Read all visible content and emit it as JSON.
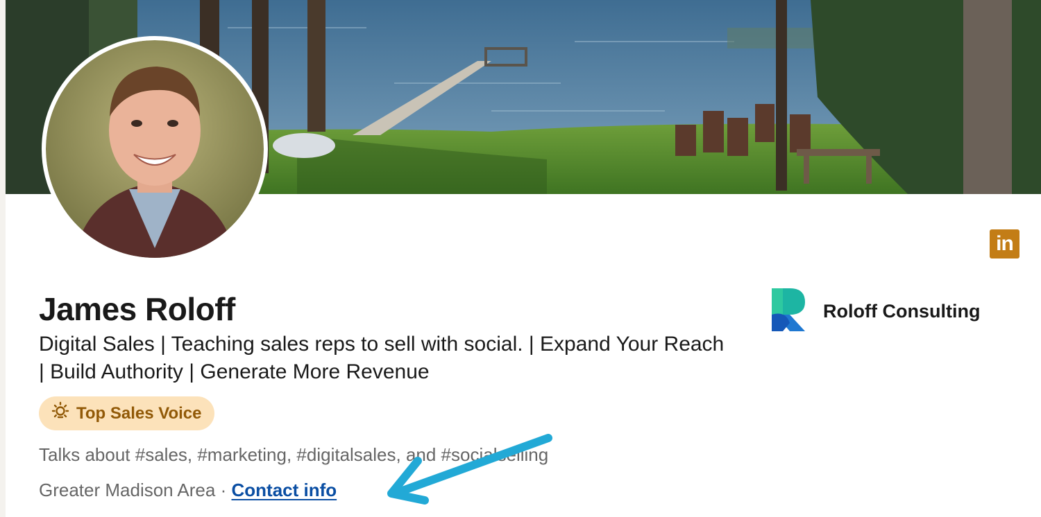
{
  "profile": {
    "name": "James Roloff",
    "headline": "Digital Sales | Teaching sales reps to sell with social. | Expand Your Reach | Build Authority | Generate More Revenue",
    "badge": "Top Sales Voice",
    "talks_about": "Talks about #sales, #marketing, #digitalsales, and #socialselling",
    "location": "Greater Madison Area",
    "separator": "·",
    "contact_link": "Contact info"
  },
  "company": {
    "name": "Roloff Consulting"
  },
  "brand_icon": {
    "text": "in",
    "color": "#c37d16"
  },
  "icons": {
    "badge": "lightbulb-icon",
    "company": "roloff-r-logo-icon",
    "linkedin": "linkedin-icon"
  },
  "colors": {
    "link": "#0a4ea3",
    "badge_bg": "#fce2ba",
    "badge_text": "#915907",
    "annotation_arrow": "#22a9d6"
  }
}
